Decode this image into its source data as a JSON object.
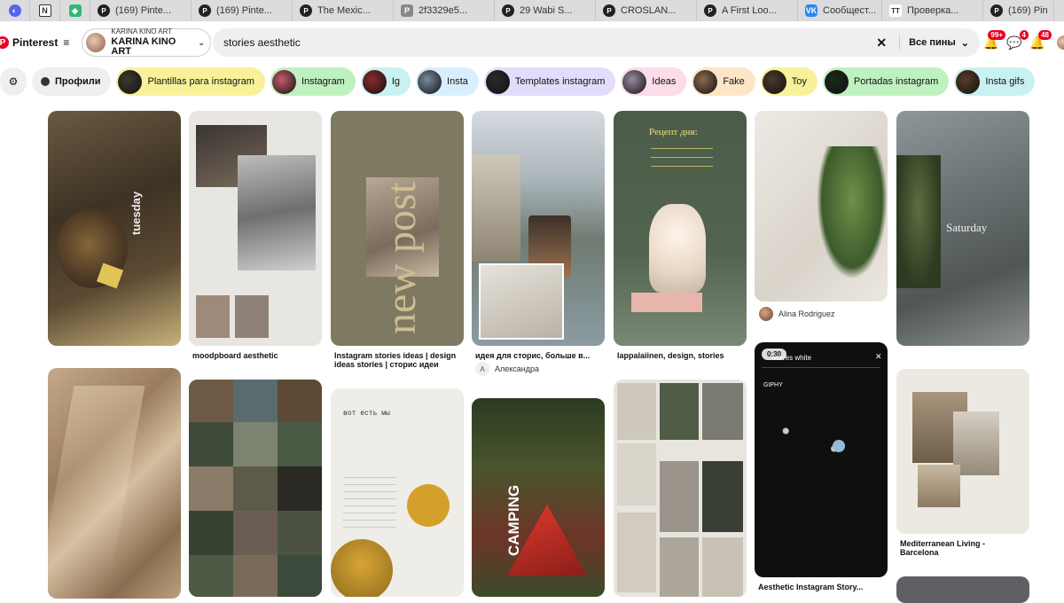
{
  "tabs": [
    {
      "label": "",
      "icon": "discord-icon"
    },
    {
      "label": "",
      "icon": "notion-icon"
    },
    {
      "label": "",
      "icon": "green-tag-icon"
    },
    {
      "label": "(169) Pinte...",
      "icon": "pinterest-icon"
    },
    {
      "label": "(169) Pinte...",
      "icon": "pinterest-icon"
    },
    {
      "label": "The Mexic...",
      "icon": "pinterest-icon"
    },
    {
      "label": "2f3329e5...",
      "icon": "p-icon"
    },
    {
      "label": "29 Wabi S...",
      "icon": "pinterest-icon"
    },
    {
      "label": "CROSLAN...",
      "icon": "pinterest-icon"
    },
    {
      "label": "A First Loo...",
      "icon": "pinterest-icon"
    },
    {
      "label": "Сообщест...",
      "icon": "vk-icon"
    },
    {
      "label": "Проверка...",
      "icon": "tt-icon"
    },
    {
      "label": "(169) Pin",
      "icon": "pinterest-icon"
    }
  ],
  "header": {
    "logo_text": "Pinterest",
    "profile_small": "KARINA KINO ART",
    "profile_big": "KARINA KINO ART",
    "search_value": "stories aesthetic",
    "search_scope": "Все пины",
    "notifications_badge": "99+",
    "messages_badge": "4",
    "updates_badge": "48"
  },
  "chips": {
    "profiles_label": "Профили",
    "items": [
      {
        "label": "Plantillas para instagram",
        "bg": "#f8f19a"
      },
      {
        "label": "Instagram",
        "bg": "#bff0bf"
      },
      {
        "label": "Ig",
        "bg": "#c8f1f1"
      },
      {
        "label": "Insta",
        "bg": "#d9eefc"
      },
      {
        "label": "Templates instagram",
        "bg": "#e3dcfb"
      },
      {
        "label": "Ideas",
        "bg": "#fbdce8"
      },
      {
        "label": "Fake",
        "bg": "#fde6c8"
      },
      {
        "label": "Toy",
        "bg": "#f8f19a"
      },
      {
        "label": "Portadas instagram",
        "bg": "#bff0bf"
      },
      {
        "label": "Insta gifs",
        "bg": "#c8f1f1"
      }
    ]
  },
  "pins": {
    "p1_text_day": "tuesday",
    "p2_title": "moodpboard aesthetic",
    "p3_overlay": "new post",
    "p3_title": "Instagram stories ideas | design ideas stories | сторис идеи",
    "p4_title": "идея для сторис, больше в...",
    "p4_author_initial": "А",
    "p4_author": "Александра",
    "p5_title": "lappalaiinen, design, stories",
    "p5_board": "Рецепт дня:",
    "p6_author": "Alina Rodriguez",
    "p7_overlay": "Saturday",
    "p10_top": "вот есть мы",
    "p11_overlay": "CAMPING",
    "p13_time": "0:30",
    "p13_search": "leaves white",
    "p13_giphy": "GIPHY",
    "p13_title": "Aesthetic Instagram Story...",
    "p14_title": "Mediterranean Living - Barcelona"
  }
}
